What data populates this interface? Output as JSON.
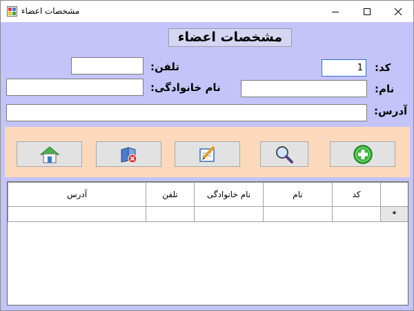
{
  "window": {
    "title": "مشخصات اعضاء"
  },
  "form": {
    "heading": "مشخصات اعضاء",
    "code_label": "کد:",
    "code_value": "1",
    "name_label": "نام:",
    "name_value": "",
    "phone_label": "تلفن:",
    "phone_value": "",
    "family_label": "نام خانوادگی:",
    "family_value": "",
    "address_label": "آدرس:",
    "address_value": ""
  },
  "toolbar": {
    "buttons": [
      {
        "icon": "add-icon"
      },
      {
        "icon": "search-icon"
      },
      {
        "icon": "edit-icon"
      },
      {
        "icon": "delete-icon"
      },
      {
        "icon": "home-icon"
      }
    ]
  },
  "grid": {
    "columns": [
      "کد",
      "نام",
      "نام خانوادگی",
      "تلفن",
      "آدرس"
    ],
    "new_row_marker": "*",
    "rows": []
  },
  "colors": {
    "form_background": "#c4c4fa",
    "toolbar_background": "#fcd9bd"
  }
}
